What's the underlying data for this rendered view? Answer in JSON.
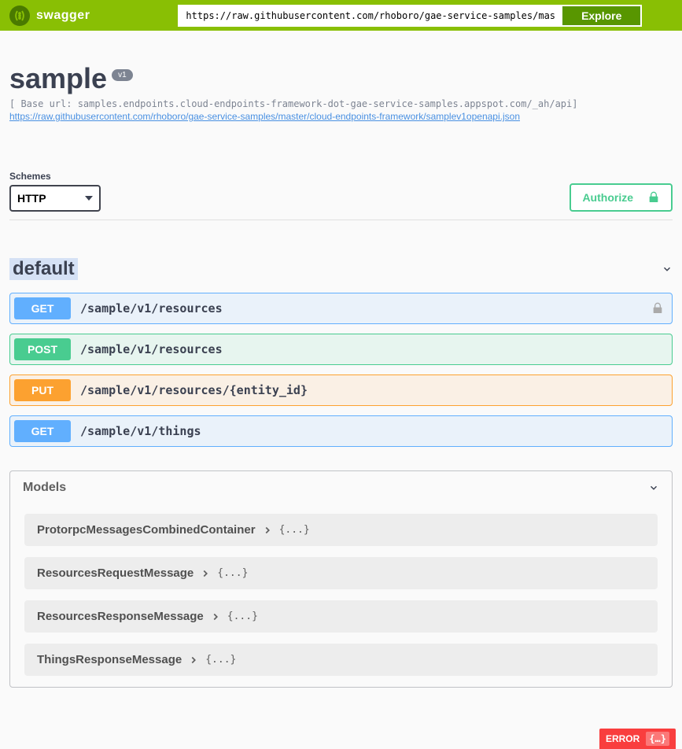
{
  "topbar": {
    "brand": "swagger",
    "url": "https://raw.githubusercontent.com/rhoboro/gae-service-samples/master/cloud-endpoints-fram",
    "explore": "Explore"
  },
  "api": {
    "title": "sample",
    "version": "v1",
    "base_url": "[ Base url: samples.endpoints.cloud-endpoints-framework-dot-gae-service-samples.appspot.com/_ah/api]",
    "spec_url": "https://raw.githubusercontent.com/rhoboro/gae-service-samples/master/cloud-endpoints-framework/samplev1openapi.json"
  },
  "schemes": {
    "label": "Schemes",
    "selected": "HTTP"
  },
  "authorize": {
    "label": "Authorize"
  },
  "tag": {
    "name": "default"
  },
  "ops": [
    {
      "method": "GET",
      "path": "/sample/v1/resources",
      "locked": true
    },
    {
      "method": "POST",
      "path": "/sample/v1/resources",
      "locked": false
    },
    {
      "method": "PUT",
      "path": "/sample/v1/resources/{entity_id}",
      "locked": false
    },
    {
      "method": "GET",
      "path": "/sample/v1/things",
      "locked": false
    }
  ],
  "models": {
    "title": "Models",
    "items": [
      {
        "name": "ProtorpcMessagesCombinedContainer",
        "brace": "{...}"
      },
      {
        "name": "ResourcesRequestMessage",
        "brace": "{...}"
      },
      {
        "name": "ResourcesResponseMessage",
        "brace": "{...}"
      },
      {
        "name": "ThingsResponseMessage",
        "brace": "{...}"
      }
    ]
  },
  "error": {
    "label": "ERROR",
    "icon": "{…}"
  }
}
